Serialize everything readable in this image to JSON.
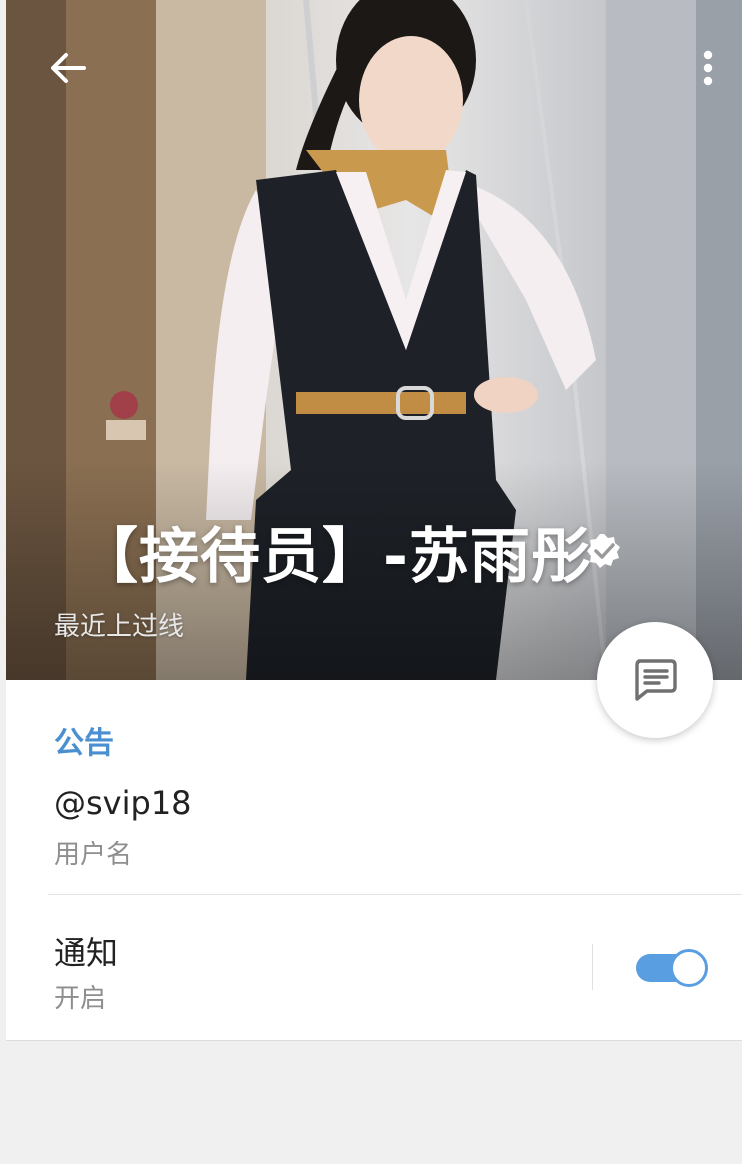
{
  "header": {
    "back_icon": "arrow-left-icon",
    "more_icon": "more-vertical-icon",
    "name": "【接待员】-苏雨彤",
    "verified_icon": "verified-badge-icon",
    "last_seen": "最近上过线"
  },
  "fab": {
    "icon": "message-icon"
  },
  "info": {
    "section_title": "公告",
    "username": "@svip18",
    "username_label": "用户名",
    "notifications_title": "通知",
    "notifications_status": "开启",
    "notifications_enabled": true
  },
  "colors": {
    "accent": "#4a8fcf",
    "toggle": "#5a9ee2",
    "background": "#f0f0f0"
  }
}
